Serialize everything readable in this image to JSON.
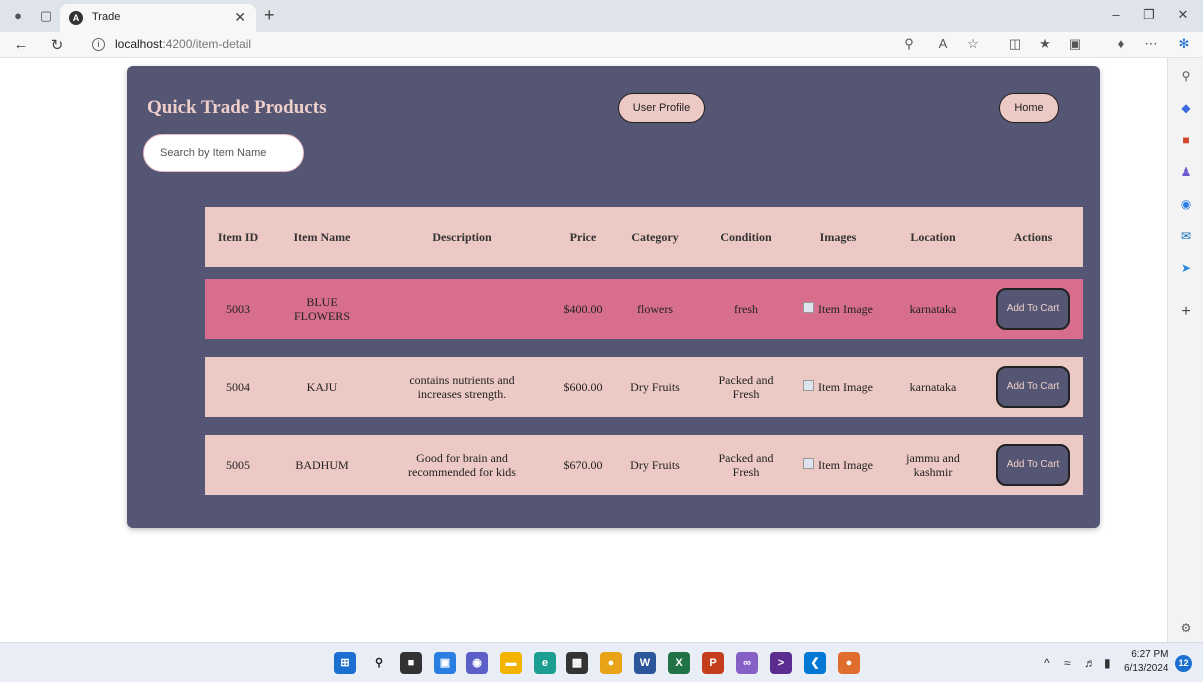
{
  "browser": {
    "tab_title": "Trade",
    "tab_favicon": "A",
    "url_host": "localhost",
    "url_rest": ":4200/item-detail"
  },
  "page": {
    "brand": "Quick Trade Products",
    "user_profile_label": "User Profile",
    "home_label": "Home",
    "search_placeholder": "Search by Item Name"
  },
  "table": {
    "headers": {
      "id": "Item ID",
      "name": "Item Name",
      "description": "Description",
      "price": "Price",
      "category": "Category",
      "condition": "Condition",
      "images": "Images",
      "location": "Location",
      "actions": "Actions"
    },
    "rows": [
      {
        "id": "5003",
        "name": "BLUE FLOWERS",
        "description": "",
        "price": "$400.00",
        "category": "flowers",
        "condition": "fresh",
        "image_alt": "Item Image",
        "location": "karnataka",
        "action": "Add To Cart"
      },
      {
        "id": "5004",
        "name": "KAJU",
        "description": "contains nutrients and increases strength.",
        "price": "$600.00",
        "category": "Dry Fruits",
        "condition": "Packed and Fresh",
        "image_alt": "Item Image",
        "location": "karnataka",
        "action": "Add To Cart"
      },
      {
        "id": "5005",
        "name": "BADHUM",
        "description": "Good for brain and recommended for kids",
        "price": "$670.00",
        "category": "Dry Fruits",
        "condition": "Packed and Fresh",
        "image_alt": "Item Image",
        "location": "jammu and kashmir",
        "action": "Add To Cart"
      }
    ]
  },
  "taskbar": {
    "time": "6:27 PM",
    "date": "6/13/2024",
    "notifications": "12"
  },
  "colors": {
    "panel": "#545673",
    "row": "#ecc9c4",
    "row_highlight": "#d76e8d",
    "accent_text": "#f0cfcb"
  }
}
